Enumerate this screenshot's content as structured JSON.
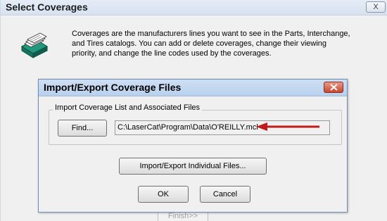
{
  "parent_window": {
    "title": "Select Coverages",
    "close_glyph": "X",
    "description": "Coverages are the manufacturers lines you want to see in the Parts, Interchange, and Tires catalogs.  You can add or delete coverages, change their viewing priority, and change the line codes used by the coverages.",
    "icon": "card-file-icon",
    "finish_label": "Finish>>"
  },
  "dialog": {
    "title": "Import/Export Coverage Files",
    "close_icon": "close-icon",
    "close_color": "#c8482f",
    "group_label": "Import Coverage List and Associated Files",
    "find_label": "Find...",
    "path_value": "C:\\LaserCat\\Program\\Data\\O'REILLY.mcl",
    "annotation": {
      "icon": "red-arrow-icon",
      "color": "#c01a1a"
    },
    "individual_label": "Import/Export Individual Files...",
    "ok_label": "OK",
    "cancel_label": "Cancel"
  }
}
